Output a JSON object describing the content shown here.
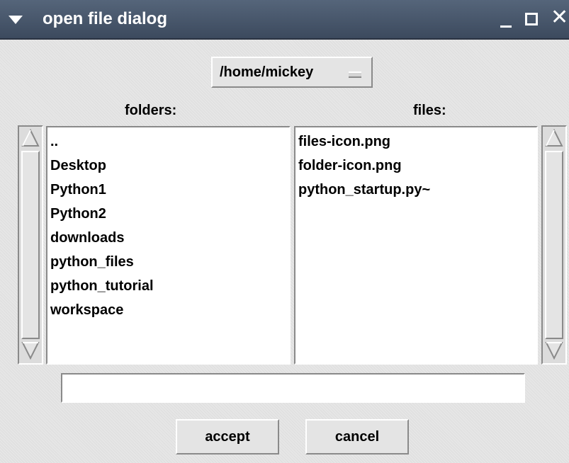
{
  "window": {
    "title": "open file dialog",
    "controls": {
      "minimize": "minimize-icon",
      "maximize": "maximize-icon",
      "close": "close-icon"
    }
  },
  "path_selector": {
    "value": "/home/mickey"
  },
  "folders": {
    "label": "folders:",
    "items": [
      {
        "label": ".."
      },
      {
        "label": "Desktop"
      },
      {
        "label": "Python1"
      },
      {
        "label": "Python2"
      },
      {
        "label": "downloads"
      },
      {
        "label": "python_files"
      },
      {
        "label": "python_tutorial"
      },
      {
        "label": "workspace"
      }
    ]
  },
  "files": {
    "label": "files:",
    "items": [
      {
        "label": "files-icon.png"
      },
      {
        "label": "folder-icon.png"
      },
      {
        "label": "python_startup.py~"
      }
    ]
  },
  "filename_entry": {
    "value": ""
  },
  "buttons": {
    "accept": "accept",
    "cancel": "cancel"
  },
  "colors": {
    "titlebar": "#4a586c",
    "background": "#e6e6e6",
    "list_background": "#ffffff"
  }
}
